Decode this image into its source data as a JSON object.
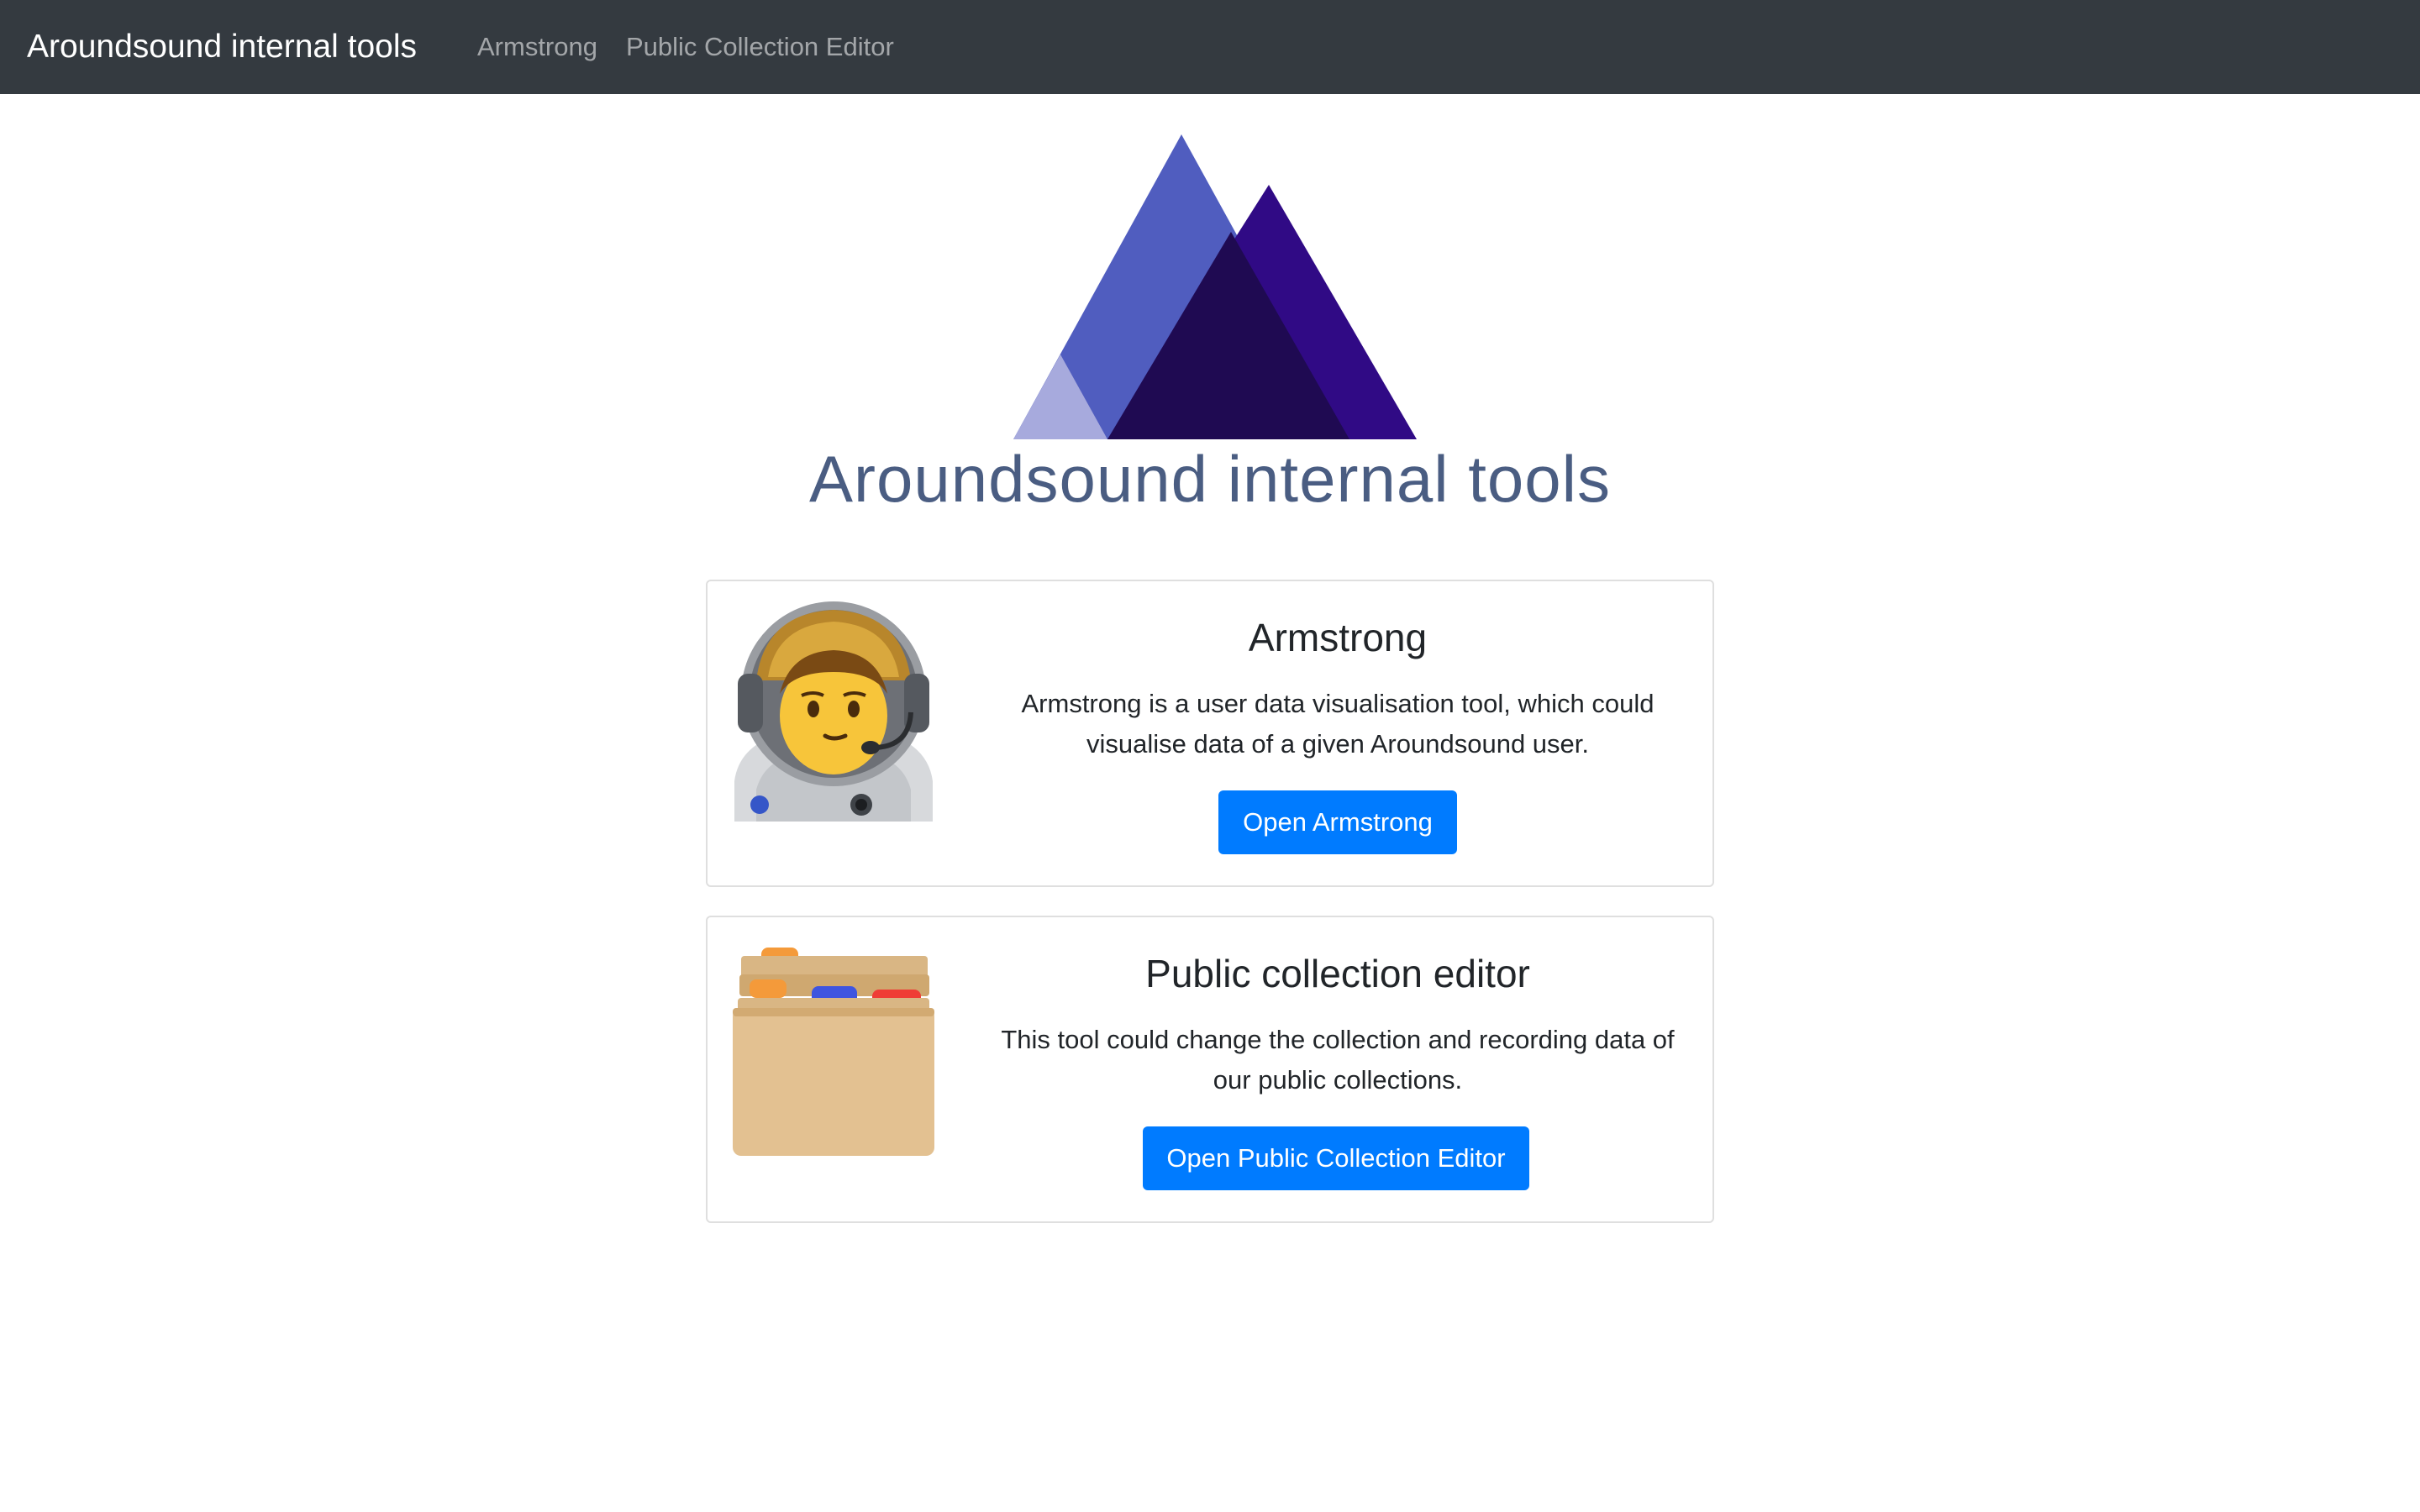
{
  "navbar": {
    "brand": "Aroundsound internal tools",
    "links": [
      "Armstrong",
      "Public Collection Editor"
    ]
  },
  "hero": {
    "title": "Aroundsound internal tools"
  },
  "cards": [
    {
      "icon": "astronaut-icon",
      "title": "Armstrong",
      "text": "Armstrong is a user data visualisation tool, which could visualise data of a given Aroundsound user.",
      "button": "Open Armstrong"
    },
    {
      "icon": "card-file-box-icon",
      "title": "Public collection editor",
      "text": "This tool could change the collection and recording data of our public collections.",
      "button": "Open Public Collection Editor"
    }
  ],
  "colors": {
    "navbar_bg": "#343a40",
    "primary": "#007bff",
    "hero_title": "#4a5d82",
    "logo_light": "#a7aadd",
    "logo_mid": "#505dbf",
    "logo_dark": "#1f0a52",
    "logo_purple": "#300a85"
  }
}
